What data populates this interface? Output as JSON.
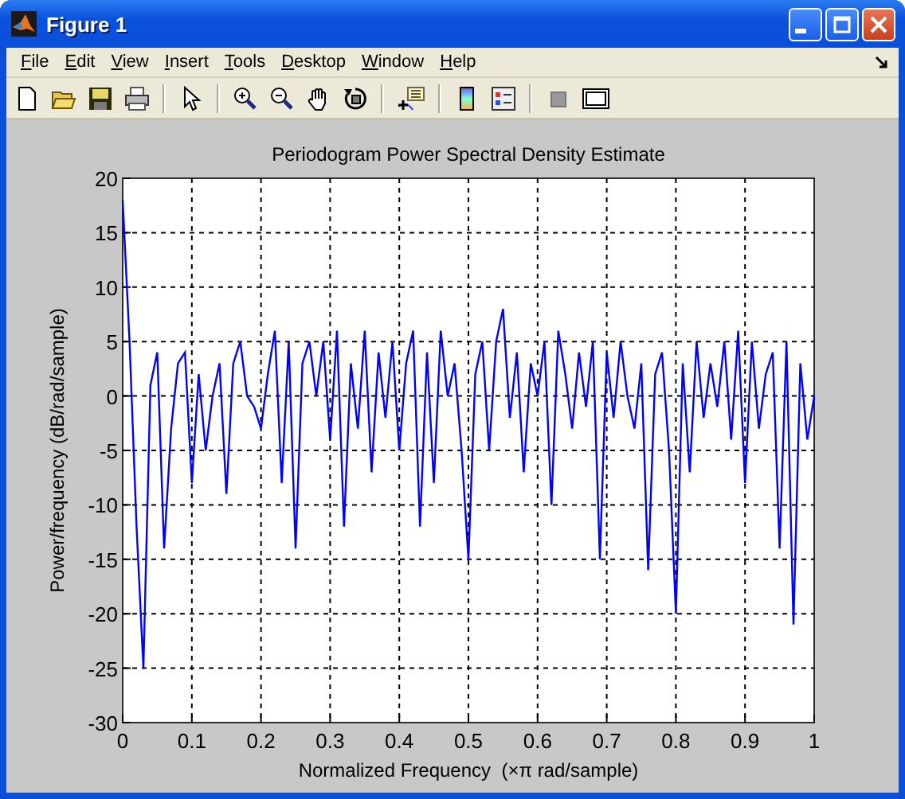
{
  "window": {
    "title": "Figure 1"
  },
  "menu": [
    {
      "label": "File"
    },
    {
      "label": "Edit"
    },
    {
      "label": "View"
    },
    {
      "label": "Insert"
    },
    {
      "label": "Tools"
    },
    {
      "label": "Desktop"
    },
    {
      "label": "Window"
    },
    {
      "label": "Help"
    }
  ],
  "plot": {
    "chart_data": {
      "type": "line",
      "title": "Periodogram Power Spectral Density Estimate",
      "xlabel": "Normalized Frequency  (×π rad/sample)",
      "ylabel": "Power/frequency (dB/rad/sample)",
      "x": [
        0,
        0.01,
        0.02,
        0.03,
        0.04,
        0.05,
        0.06,
        0.07,
        0.08,
        0.09,
        0.1,
        0.11,
        0.12,
        0.13,
        0.14,
        0.15,
        0.16,
        0.17,
        0.18,
        0.19,
        0.2,
        0.21,
        0.22,
        0.23,
        0.24,
        0.25,
        0.26,
        0.27,
        0.28,
        0.29,
        0.3,
        0.31,
        0.32,
        0.33,
        0.34,
        0.35,
        0.36,
        0.37,
        0.38,
        0.39,
        0.4,
        0.41,
        0.42,
        0.43,
        0.44,
        0.45,
        0.46,
        0.47,
        0.48,
        0.49,
        0.5,
        0.51,
        0.52,
        0.53,
        0.54,
        0.55,
        0.56,
        0.57,
        0.58,
        0.59,
        0.6,
        0.61,
        0.62,
        0.63,
        0.64,
        0.65,
        0.66,
        0.67,
        0.68,
        0.69,
        0.7,
        0.71,
        0.72,
        0.73,
        0.74,
        0.75,
        0.76,
        0.77,
        0.78,
        0.79,
        0.8,
        0.81,
        0.82,
        0.83,
        0.84,
        0.85,
        0.86,
        0.87,
        0.88,
        0.89,
        0.9,
        0.91,
        0.92,
        0.93,
        0.94,
        0.95,
        0.96,
        0.97,
        0.98,
        0.99,
        1
      ],
      "values": [
        18,
        5,
        -12,
        -25,
        1,
        4,
        -14,
        -3,
        3,
        4,
        -8,
        2,
        -5,
        0,
        3,
        -9,
        3,
        5,
        0,
        -1,
        -3,
        2,
        6,
        -8,
        5,
        -14,
        3,
        5,
        0,
        5,
        -4,
        6,
        -12,
        3,
        -3,
        6,
        -7,
        4,
        -2,
        5,
        -5,
        3,
        6,
        -12,
        4,
        -8,
        6,
        0,
        3,
        -5,
        -15,
        2,
        5,
        -5,
        5,
        8,
        -2,
        4,
        -7,
        3,
        0,
        5,
        -10,
        6,
        2,
        -3,
        4,
        -1,
        5,
        -15,
        4,
        -2,
        5,
        0,
        -3,
        3,
        -16,
        2,
        4,
        -5,
        -20,
        3,
        -7,
        5,
        -2,
        3,
        -1,
        5,
        -4,
        6,
        -8,
        5,
        -3,
        2,
        4,
        -14,
        5,
        -21,
        3,
        -4,
        0
      ],
      "grid": true,
      "xlim": [
        0,
        1
      ],
      "ylim": [
        -30,
        20
      ],
      "xticks": [
        0,
        0.1,
        0.2,
        0.3,
        0.4,
        0.5,
        0.6,
        0.7,
        0.8,
        0.9,
        1
      ],
      "yticks": [
        20,
        15,
        10,
        5,
        0,
        -5,
        -10,
        -15,
        -20,
        -25,
        -30
      ]
    }
  }
}
